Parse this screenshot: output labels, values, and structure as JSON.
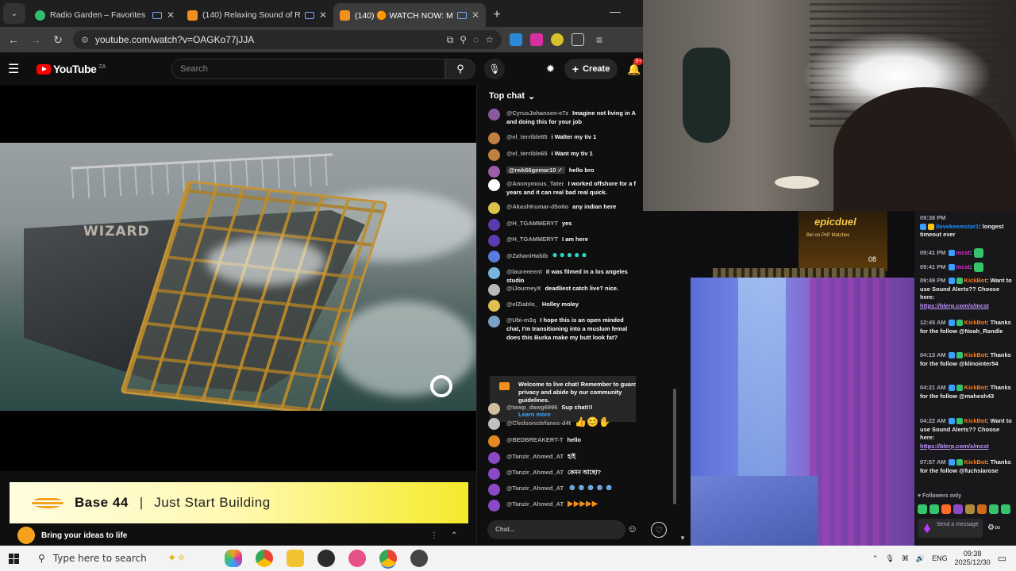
{
  "browser": {
    "tabs": [
      {
        "title": "Radio Garden – Favorites",
        "color": "#2fbf71"
      },
      {
        "title": "(140) Relaxing Sound of Ra",
        "color": "#f38f1d"
      },
      {
        "title": "(140) 🟠 WATCH NOW: Mo",
        "color": "#f38f1d"
      }
    ],
    "url": "youtube.com/watch?v=OAGKo77jJJA"
  },
  "youtube": {
    "logo": "YouTube",
    "country": "ZA",
    "search_placeholder": "Search",
    "create_label": "Create",
    "notification_count": "9+"
  },
  "video": {
    "ship_name": "WIZARD"
  },
  "ad": {
    "brand": "Base 44",
    "separator": "|",
    "tagline": "Just Start Building",
    "footer_text": "Bring your ideas to life"
  },
  "chat": {
    "header": "Top chat",
    "messages": [
      {
        "author": "@CyrusJohansen-e7z",
        "text": "Imagine not living in A",
        "text2": "and doing this for your job",
        "avatar": "#8a5a9a"
      },
      {
        "author": "@el_terrible65",
        "text": "i Walter my tiv 1",
        "avatar": "#c08040"
      },
      {
        "author": "@el_terrible65",
        "text": "i Want my tiv 1",
        "avatar": "#c08040"
      },
      {
        "author": "@rwk66gemar10 ✓",
        "text": "hello bro",
        "avatar": "#9b5ca8"
      },
      {
        "author": "@Anonymous_Tater",
        "text": "I worked offshore for a f",
        "text2": "years and it can real bad real quick.",
        "avatar": "#ffffff"
      },
      {
        "author": "@AkashKumar-d5o6o",
        "text": "any indian here",
        "avatar": "#d9c34a"
      },
      {
        "author": "@H_TGAMMERYT",
        "text": "yes",
        "avatar": "#5c3ab0"
      },
      {
        "author": "@H_TGAMMERYT",
        "text": "I am here",
        "avatar": "#5c3ab0"
      },
      {
        "author": "@ZahaniHabib",
        "text": "",
        "avatar": "#5b7be0"
      },
      {
        "author": "@laureeeent",
        "text": "it was filmed in a los angeles studio",
        "avatar": "#78b6e0"
      },
      {
        "author": "@iJourneyX",
        "text": "deadliest catch live? nice.",
        "avatar": "#b8b8b8"
      },
      {
        "author": "@elZiablo_",
        "text": "Holley moley",
        "avatar": "#e0c050"
      },
      {
        "author": "@Ubi-m3q",
        "text": "I hope this is an open minded",
        "text2": "chat, I'm transitioning into a muslum femal",
        "text3": "does this Burka make my butt look fat?",
        "avatar": "#7aa0c8"
      },
      {
        "author": "@tawp_dawg6996",
        "text": "Sup chat!!!",
        "avatar": "#d0c0a0"
      },
      {
        "author": "@Cledsonstefanes-d4t",
        "text": "",
        "avatar": "#c0c0c0"
      },
      {
        "author": "@BEDBREAKERT-T",
        "text": "hello",
        "avatar": "#e08a20"
      },
      {
        "author": "@Tanzir_Ahmed_AT",
        "text": "হাই",
        "avatar": "#8a4ac8"
      },
      {
        "author": "@Tanzir_Ahmed_AT",
        "text": "কেমন আছো?",
        "avatar": "#8a4ac8"
      },
      {
        "author": "@Tanzir_Ahmed_AT",
        "text": "",
        "avatar": "#8a4ac8"
      },
      {
        "author": "@Tanzir_Ahmed_AT",
        "text": "",
        "avatar": "#8a4ac8"
      }
    ],
    "notice_text": "Welcome to live chat! Remember to guard your privacy and abide by our community guidelines.",
    "learn_more": "Learn more",
    "input_placeholder": "Chat..."
  },
  "overlay": {
    "banner_logo": "epicduel",
    "banner_sub": "Bet on PvP Matches",
    "banner_count": "08"
  },
  "twitch": {
    "messages": [
      {
        "time": "09:38 PM",
        "name": "ilovekeemstar1",
        "text": ": longest timeout ever"
      },
      {
        "time": "09:41 PM",
        "name": "mcst",
        "text": ":"
      },
      {
        "time": "09:41 PM",
        "name": "mcst",
        "text": ":"
      },
      {
        "time": "09:49 PM",
        "name": "KickBot",
        "text": ": Want to use Sound Alerts?? Choose here:",
        "link": "https://blerp.com/x/mcst"
      },
      {
        "time": "12:45 AM",
        "name": "KickBot",
        "text": ": Thanks for the follow @Noah_Randle"
      },
      {
        "time": "04:13 AM",
        "name": "KickBot",
        "text": ": Thanks for the follow @klinointer54"
      },
      {
        "time": "04:21 AM",
        "name": "KickBot",
        "text": ": Thanks for the follow @mahesh43"
      },
      {
        "time": "04:22 AM",
        "name": "KickBot",
        "text": ": Want to use Sound Alerts?? Choose here:",
        "link": "https://blerp.com/x/mcst"
      },
      {
        "time": "07:57 AM",
        "name": "KickBot",
        "text": ": Thanks for the follow @fuchsiarose"
      }
    ],
    "followers_only": "Followers only",
    "send_placeholder": "Send a message"
  },
  "taskbar": {
    "search_placeholder": "Type here to search",
    "language": "ENG",
    "time": "09:38",
    "date": "2025/12/30"
  }
}
